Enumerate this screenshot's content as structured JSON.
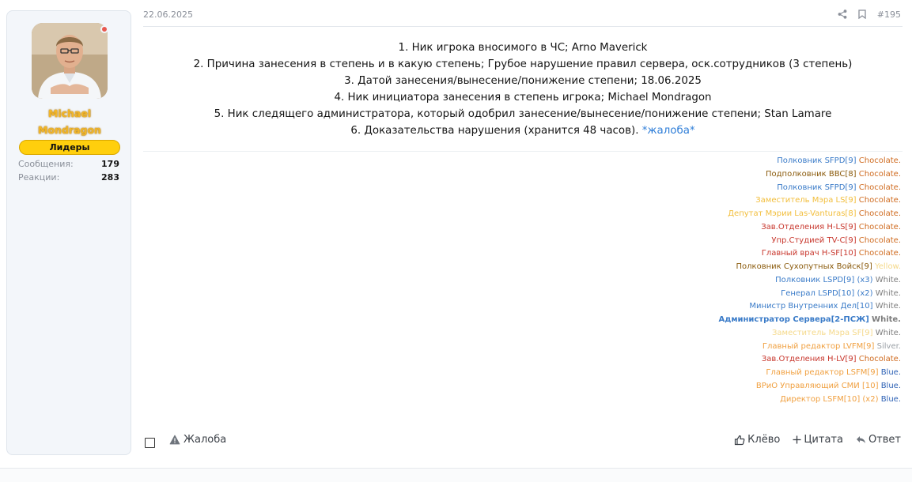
{
  "user": {
    "name_line1": "Michael",
    "name_line2": "Mondragon",
    "title": "Лидеры",
    "stats": [
      {
        "label": "Сообщения:",
        "value": "179"
      },
      {
        "label": "Реакции:",
        "value": "283"
      }
    ],
    "name_color": "#f2b62a",
    "title_bg": "#ffcf0d",
    "online_color": "#e8584e"
  },
  "post": {
    "date": "22.06.2025",
    "number": "#195",
    "lines": [
      "1. Ник игрока вносимого в ЧС; Arno Maverick",
      "2. Причина занесения в степень и в какую степень; Грубое нарушение правил сервера, оск.сотрудников (3 степень)",
      "3. Датой занесения/вынесение/понижение степени; 18.06.2025",
      "4. Ник инициатора занесения в степень игрока; Michael Mondragon",
      "5. Ник следящего администратора, который одобрил занесение/вынесение/понижение степени; Stan Lamare"
    ],
    "line6_text": "6. Доказательства нарушения (хранится 48 часов). ",
    "line6_link": "*жалоба*",
    "link_color": "#2f7ed8"
  },
  "signature": [
    {
      "role": "Полковник SFPD[9]",
      "tag": "Chocolate.",
      "rc": "c-blue",
      "tc": "c-choc"
    },
    {
      "role": "Подполковник BBC[8]",
      "tag": "Chocolate.",
      "rc": "c-brown",
      "tc": "c-choc"
    },
    {
      "role": "Полковник SFPD[9]",
      "tag": "Chocolate.",
      "rc": "c-blue",
      "tc": "c-choc"
    },
    {
      "role": "Заместитель Мэра LS[9]",
      "tag": "Chocolate.",
      "rc": "c-yellow",
      "tc": "c-choc"
    },
    {
      "role": "Депутат Мэрии Las-Vanturas[8]",
      "tag": "Chocolate.",
      "rc": "c-yellow",
      "tc": "c-choc"
    },
    {
      "role": "Зав.Отделения H-LS[9]",
      "tag": "Chocolate.",
      "rc": "c-red",
      "tc": "c-choc"
    },
    {
      "role": "Упр.Студией TV-C[9]",
      "tag": "Chocolate.",
      "rc": "c-red",
      "tc": "c-choc"
    },
    {
      "role": "Главный врач H-SF[10]",
      "tag": "Chocolate.",
      "rc": "c-red",
      "tc": "c-choc"
    },
    {
      "role": "Полковник Сухопутных Войск[9]",
      "tag": "Yellow.",
      "rc": "c-brown",
      "tc": "c-yellowlt"
    },
    {
      "role": "Полковник LSPD[9] (x3)",
      "tag": "White.",
      "rc": "c-blue",
      "tc": "c-white"
    },
    {
      "role": "Генерал LSPD[10] (x2)",
      "tag": "White.",
      "rc": "c-blue",
      "tc": "c-white"
    },
    {
      "role": "Министр Внутренних Дел[10]",
      "tag": "White.",
      "rc": "c-blue",
      "tc": "c-white"
    },
    {
      "role": "Администратор Сервера[2-ПСЖ]",
      "tag": "White.",
      "rc": "c-blue c-bold",
      "tc": "c-white c-bold"
    },
    {
      "role": "Заместитель Мэра SF[9]",
      "tag": "White.",
      "rc": "c-yellowlt",
      "tc": "c-white"
    },
    {
      "role": "Главный редактор LVFM[9]",
      "tag": "Silver.",
      "rc": "c-orange",
      "tc": "c-silver"
    },
    {
      "role": "Зав.Отделения H-LV[9]",
      "tag": "Chocolate.",
      "rc": "c-red",
      "tc": "c-choc"
    },
    {
      "role": "Главный редактор LSFM[9]",
      "tag": "Blue.",
      "rc": "c-orange",
      "tc": "c-blue2"
    },
    {
      "role": "ВРиО Управляющий СМИ [10]",
      "tag": "Blue.",
      "rc": "c-orange",
      "tc": "c-blue2"
    },
    {
      "role": "Директор LSFM[10] (x2)",
      "tag": "Blue.",
      "rc": "c-orange",
      "tc": "c-blue2"
    }
  ],
  "actions": {
    "report": "Жалоба",
    "like": "Клёво",
    "quote": "Цитата",
    "reply": "Ответ"
  },
  "icons": {
    "share": "share-icon",
    "bookmark": "bookmark-icon",
    "report": "warning-icon",
    "like": "thumbs-up-icon",
    "quote": "plus-icon",
    "reply": "reply-arrow-icon"
  }
}
